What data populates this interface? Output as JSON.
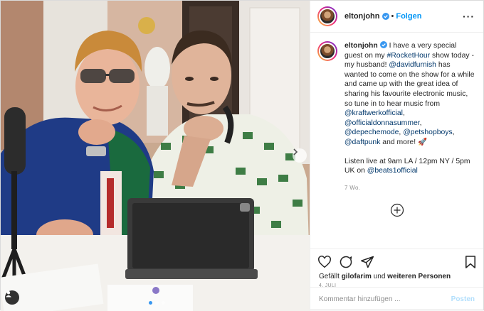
{
  "header": {
    "username": "eltonjohn",
    "separator": "•",
    "follow_label": "Folgen",
    "more_label": "···"
  },
  "caption": {
    "username": "eltonjohn",
    "text_1": " I have a very special guest on my ",
    "tag_rocket": "#RocketHour",
    "text_2": " show today - my husband! ",
    "mention_david": "@davidfurnish",
    "text_3": " has wanted to come on the show for a while and came up with the great idea of sharing his favourite electronic music, so tune in to hear music from ",
    "mention_kraftwerk": "@kraftwerkofficial",
    "comma_1": ", ",
    "mention_donna": "@officialdonnasummer",
    "comma_2": ", ",
    "mention_depeche": "@depechemode",
    "comma_3": ", ",
    "mention_petshop": "@petshopboys",
    "comma_4": ", ",
    "mention_daftpunk": "@daftpunk",
    "text_4": " and more! 🚀",
    "listen_text": "Listen live at 9am LA / 12pm NY / 5pm UK on ",
    "mention_beats": "@beats1official",
    "age": "7 Wo."
  },
  "likes": {
    "prefix": "Gefällt ",
    "user": "gilofarim",
    "middle": " und ",
    "others": "weiteren Personen"
  },
  "date": "4. JULI",
  "comment": {
    "placeholder": "Kommentar hinzufügen ...",
    "post_label": "Posten"
  },
  "carousel": {
    "total": 3,
    "active": 1
  },
  "colors": {
    "accent": "#0095f6",
    "link": "#00376b",
    "muted": "#8e8e8e"
  },
  "icons": [
    "verified-badge-icon",
    "more-options-icon",
    "add-comment-plus-icon",
    "heart-icon",
    "comment-icon",
    "share-icon",
    "bookmark-icon",
    "chevron-right-icon",
    "user-tag-icon"
  ]
}
